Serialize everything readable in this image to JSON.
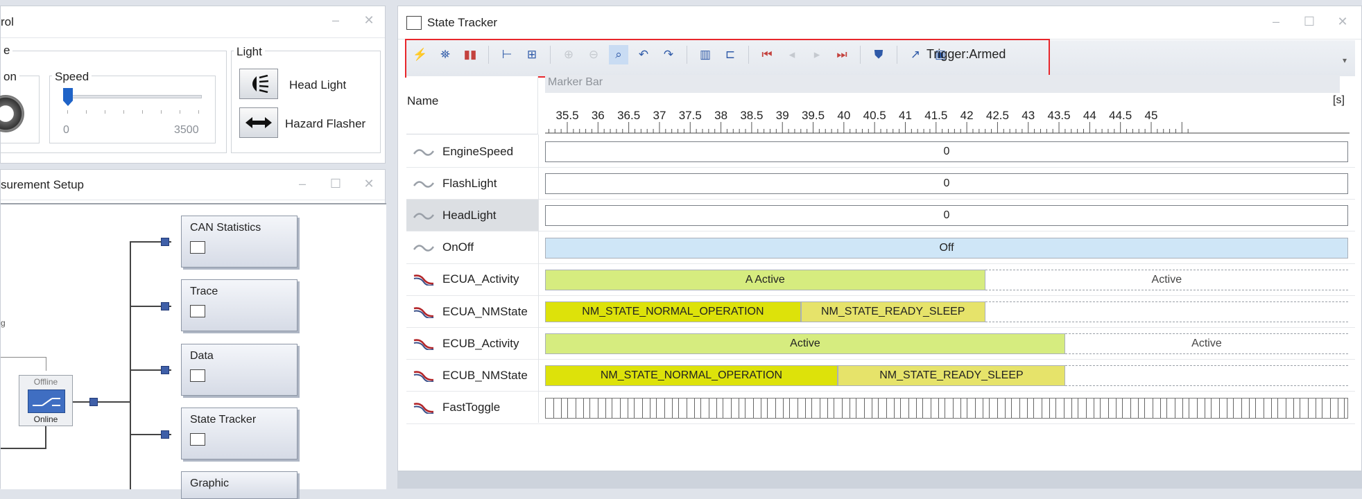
{
  "control_panel": {
    "title": "rol",
    "ignition_group_label": "e",
    "ignition_label": "on",
    "speed_label": "Speed",
    "speed_min": "0",
    "speed_max": "3500",
    "speed_value_fraction": 0.0,
    "light_group_label": "Light",
    "head_light_label": "Head Light",
    "hazard_flasher_label": "Hazard Flasher"
  },
  "measurement_setup": {
    "title": "surement Setup",
    "switch_top_label": "Offline",
    "switch_bottom_label": "Online",
    "side_label": "g",
    "blocks": [
      {
        "name": "CAN Statistics"
      },
      {
        "name": "Trace"
      },
      {
        "name": "Data"
      },
      {
        "name": "State Tracker"
      },
      {
        "name": "Graphic"
      }
    ]
  },
  "state_tracker": {
    "title": "State Tracker",
    "trigger_status": "Trigger:Armed",
    "marker_bar_label": "Marker Bar",
    "name_column_header": "Name",
    "axis_unit": "[s]",
    "axis_ticks": [
      "35.5",
      "36",
      "36.5",
      "37",
      "37.5",
      "38",
      "38.5",
      "39",
      "39.5",
      "40",
      "40.5",
      "41",
      "41.5",
      "42",
      "42.5",
      "43",
      "43.5",
      "44",
      "44.5",
      "45"
    ],
    "signals": [
      {
        "name": "EngineSpeed",
        "type": "analog",
        "segments": [
          {
            "label": "0",
            "from": 35.5,
            "to": 45.5,
            "color": "#ffffff"
          }
        ]
      },
      {
        "name": "FlashLight",
        "type": "analog",
        "segments": [
          {
            "label": "0",
            "from": 35.5,
            "to": 45.5,
            "color": "#ffffff"
          }
        ]
      },
      {
        "name": "HeadLight",
        "type": "analog",
        "selected": true,
        "segments": [
          {
            "label": "0",
            "from": 35.5,
            "to": 45.5,
            "color": "#ffffff"
          }
        ]
      },
      {
        "name": "OnOff",
        "type": "analog",
        "segments": [
          {
            "label": "Off",
            "from": 35.5,
            "to": 45.5,
            "color": "#cfe6f7"
          }
        ]
      },
      {
        "name": "ECUA_Activity",
        "type": "state",
        "segments": [
          {
            "label": "A  Active",
            "from": 35.5,
            "to": 42.3,
            "color": "#d6ec7f"
          },
          {
            "label": "Active",
            "from": 42.3,
            "to": 45.5,
            "color": "dashed"
          }
        ]
      },
      {
        "name": "ECUA_NMState",
        "type": "state",
        "segments": [
          {
            "label": "NM_STATE_NORMAL_OPERATION",
            "from": 35.5,
            "to": 39.3,
            "color": "#dde20a"
          },
          {
            "label": "NM_STATE_READY_SLEEP",
            "from": 39.3,
            "to": 42.3,
            "color": "#e6e36a"
          },
          {
            "label": "",
            "from": 42.3,
            "to": 45.5,
            "color": "dashed"
          }
        ]
      },
      {
        "name": "ECUB_Activity",
        "type": "state",
        "segments": [
          {
            "label": "Active",
            "from": 35.5,
            "to": 43.6,
            "color": "#d6ec7f"
          },
          {
            "label": "Active",
            "from": 43.6,
            "to": 45.5,
            "color": "dashed"
          }
        ]
      },
      {
        "name": "ECUB_NMState",
        "type": "state",
        "segments": [
          {
            "label": "NM_STATE_NORMAL_OPERATION",
            "from": 35.5,
            "to": 39.9,
            "color": "#dde20a"
          },
          {
            "label": "NM_STATE_READY_SLEEP",
            "from": 39.9,
            "to": 43.6,
            "color": "#e6e36a"
          },
          {
            "label": "",
            "from": 43.6,
            "to": 45.5,
            "color": "dashed"
          }
        ]
      },
      {
        "name": "FastToggle",
        "type": "state",
        "segments": [
          {
            "label": "",
            "from": 35.5,
            "to": 45.5,
            "color": "toggle"
          }
        ]
      }
    ],
    "toolbar_icons": [
      "cursor-icon",
      "binoculars-icon",
      "stop-icon",
      "fit-horizontal-icon",
      "fit-all-icon",
      "zoom-in-icon",
      "zoom-out-icon",
      "zoom-box-icon",
      "undo-icon",
      "redo-icon",
      "chart-icon",
      "chart-add-icon",
      "first-marker-icon",
      "prev-marker-icon",
      "next-marker-icon",
      "last-marker-icon",
      "bookmark-icon",
      "measure-icon",
      "window-icon"
    ]
  }
}
